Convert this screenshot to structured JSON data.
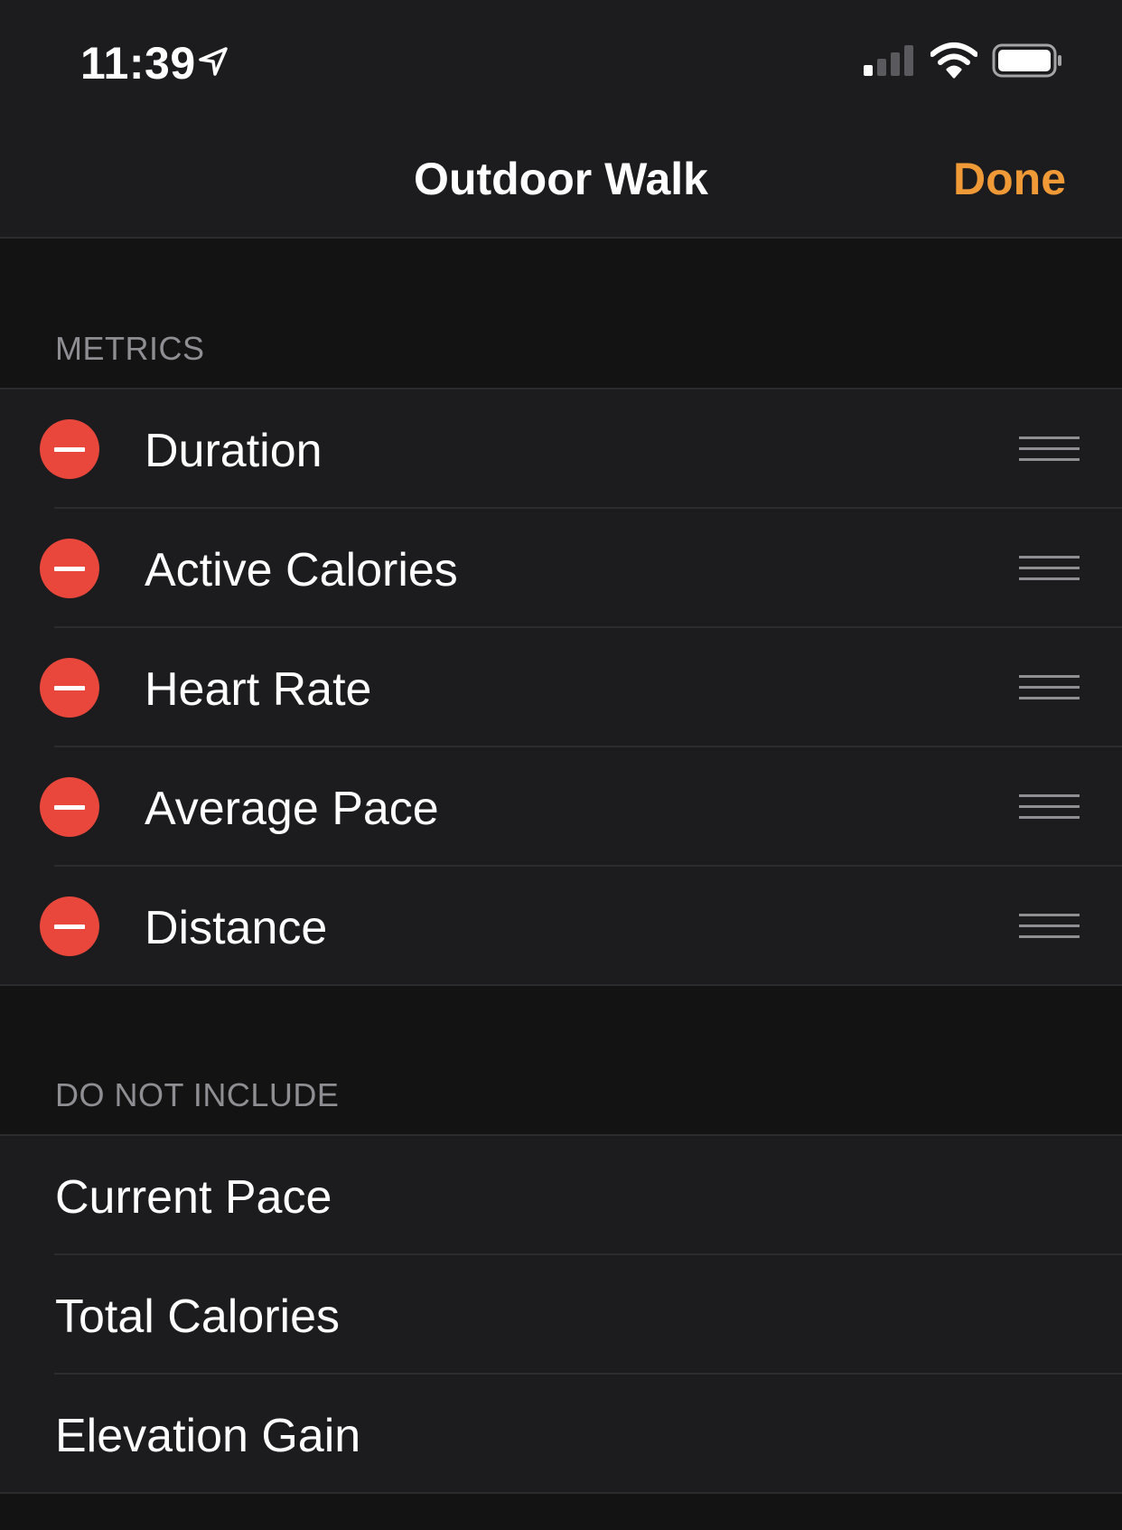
{
  "status_bar": {
    "time": "11:39",
    "location_icon": "location-arrow-icon",
    "signal_icon": "cellular-signal-icon",
    "wifi_icon": "wifi-icon",
    "battery_icon": "battery-icon"
  },
  "nav": {
    "title": "Outdoor Walk",
    "done_label": "Done"
  },
  "colors": {
    "accent": "#f09a37",
    "remove": "#e9473c",
    "background": "#131313",
    "cell": "#1c1c1e",
    "secondary_text": "#8e8e93"
  },
  "metrics": {
    "header": "METRICS",
    "items": [
      {
        "label": "Duration"
      },
      {
        "label": "Active Calories"
      },
      {
        "label": "Heart Rate"
      },
      {
        "label": "Average Pace"
      },
      {
        "label": "Distance"
      }
    ]
  },
  "do_not_include": {
    "header": "DO NOT INCLUDE",
    "items": [
      {
        "label": "Current Pace"
      },
      {
        "label": "Total Calories"
      },
      {
        "label": "Elevation Gain"
      }
    ]
  }
}
